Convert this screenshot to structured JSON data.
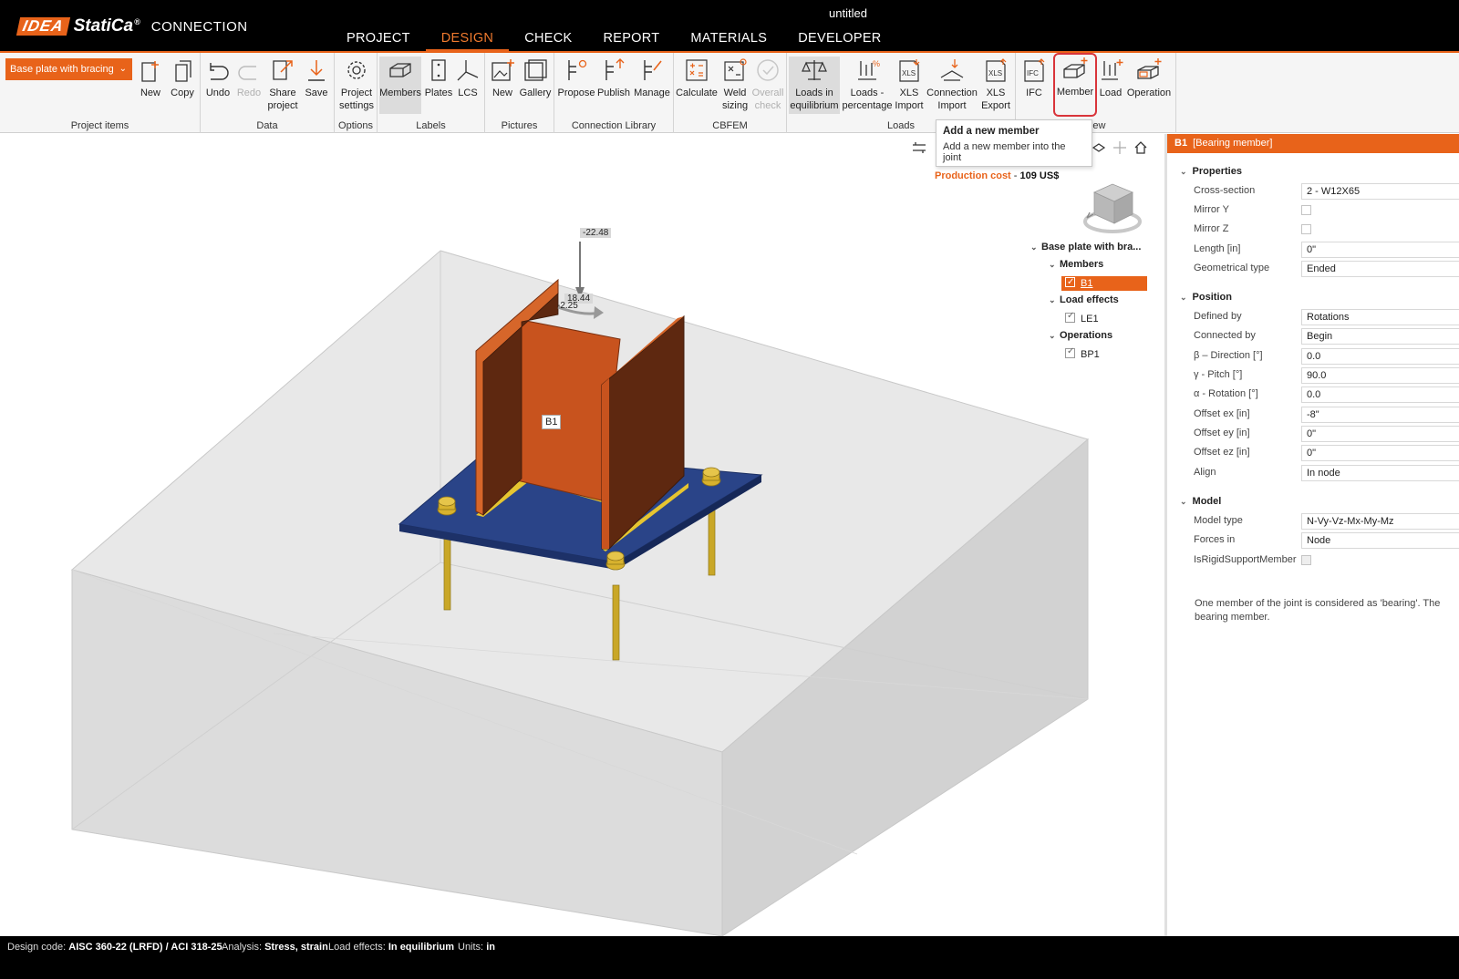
{
  "app": {
    "title": "untitled",
    "logo_idea": "IDEA",
    "logo_statica": "StatiCa",
    "logo_reg": "®",
    "logo_product": "CONNECTION"
  },
  "menu": [
    "PROJECT",
    "DESIGN",
    "CHECK",
    "REPORT",
    "MATERIALS",
    "DEVELOPER"
  ],
  "ribbon": {
    "project_dropdown": "Base plate with bracing",
    "groups": {
      "project_items": "Project items",
      "data": "Data",
      "options": "Options",
      "labels": "Labels",
      "pictures": "Pictures",
      "connection_library": "Connection Library",
      "cbfem": "CBFEM",
      "loads": "Loads",
      "new": "New"
    },
    "buttons": {
      "new": "New",
      "copy": "Copy",
      "undo": "Undo",
      "redo": "Redo",
      "share_project": "Share\nproject",
      "save": "Save",
      "project_settings": "Project\nsettings",
      "members": "Members",
      "plates": "Plates",
      "lcs": "LCS",
      "pic_new": "New",
      "gallery": "Gallery",
      "propose": "Propose",
      "publish": "Publish",
      "manage": "Manage",
      "calculate": "Calculate",
      "weld_sizing": "Weld\nsizing",
      "overall_check": "Overall\ncheck",
      "loads_in_equilibrium": "Loads in\nequilibrium",
      "loads_percentage": "Loads -\npercentage",
      "xls_import": "XLS\nImport",
      "connection_import": "Connection\nImport",
      "xls_export": "XLS\nExport",
      "ifc": "IFC",
      "member": "Member",
      "load": "Load",
      "operation": "Operation"
    }
  },
  "tooltip": {
    "title": "Add a new member",
    "body": "Add a new member into the joint"
  },
  "viewport": {
    "production_cost_label": "Production cost",
    "production_cost_sep": " - ",
    "production_cost_value": "109 US$",
    "load_labels": {
      "fz": "-22.48",
      "v1": "18.44",
      "v2": "-2.25"
    },
    "member_label": "B1",
    "colors": {
      "steel": "#c8531e",
      "baseplate": "#233a7a",
      "bolt": "#d4b22a",
      "concrete": "#e2e2e2",
      "accent": "#e8631a"
    }
  },
  "tree": {
    "root": "Base plate with bra...",
    "members_header": "Members",
    "members": [
      "B1"
    ],
    "load_effects_header": "Load effects",
    "load_effects": [
      "LE1"
    ],
    "operations_header": "Operations",
    "operations": [
      "BP1"
    ]
  },
  "props": {
    "header_id": "B1",
    "header_type": "[Bearing member]",
    "sections": {
      "properties": "Properties",
      "position": "Position",
      "model": "Model"
    },
    "properties": {
      "cross_section": {
        "label": "Cross-section",
        "value": "2 - W12X65"
      },
      "mirror_y": {
        "label": "Mirror Y",
        "checked": false
      },
      "mirror_z": {
        "label": "Mirror Z",
        "checked": false
      },
      "length": {
        "label": "Length [in]",
        "value": "0\""
      },
      "geometrical_type": {
        "label": "Geometrical type",
        "value": "Ended"
      }
    },
    "position": {
      "defined_by": {
        "label": "Defined by",
        "value": "Rotations"
      },
      "connected_by": {
        "label": "Connected by",
        "value": "Begin"
      },
      "beta": {
        "label": "β – Direction [°]",
        "value": "0.0"
      },
      "gamma": {
        "label": "γ - Pitch [°]",
        "value": "90.0"
      },
      "alpha": {
        "label": "α - Rotation [°]",
        "value": "0.0"
      },
      "offset_ex": {
        "label": "Offset ex [in]",
        "value": "-8\""
      },
      "offset_ey": {
        "label": "Offset ey [in]",
        "value": "0\""
      },
      "offset_ez": {
        "label": "Offset ez [in]",
        "value": "0\""
      },
      "align": {
        "label": "Align",
        "value": "In node"
      }
    },
    "model": {
      "model_type": {
        "label": "Model type",
        "value": "N-Vy-Vz-Mx-My-Mz"
      },
      "forces_in": {
        "label": "Forces in",
        "value": "Node"
      },
      "is_rigid_support": {
        "label": "IsRigidSupportMember",
        "checked": false
      }
    },
    "description": "One member of the joint is considered as 'bearing'. The bearing member."
  },
  "status": {
    "design_code_label": "Design code:",
    "design_code": "AISC 360-22 (LRFD) / ACI 318-25",
    "analysis_label": "Analysis:",
    "analysis": "Stress, strain",
    "load_effects_label": "Load effects:",
    "load_effects": "In equilibrium",
    "units_label": "Units:",
    "units": "in"
  }
}
